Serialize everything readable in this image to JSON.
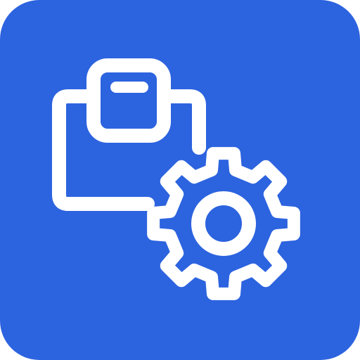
{
  "icon": {
    "name": "clipboard-gear-icon",
    "components": [
      "clipboard-icon",
      "gear-icon"
    ],
    "colors": {
      "background": "#2c63df",
      "glyph": "#ffffff",
      "page": "#ffffff"
    }
  }
}
